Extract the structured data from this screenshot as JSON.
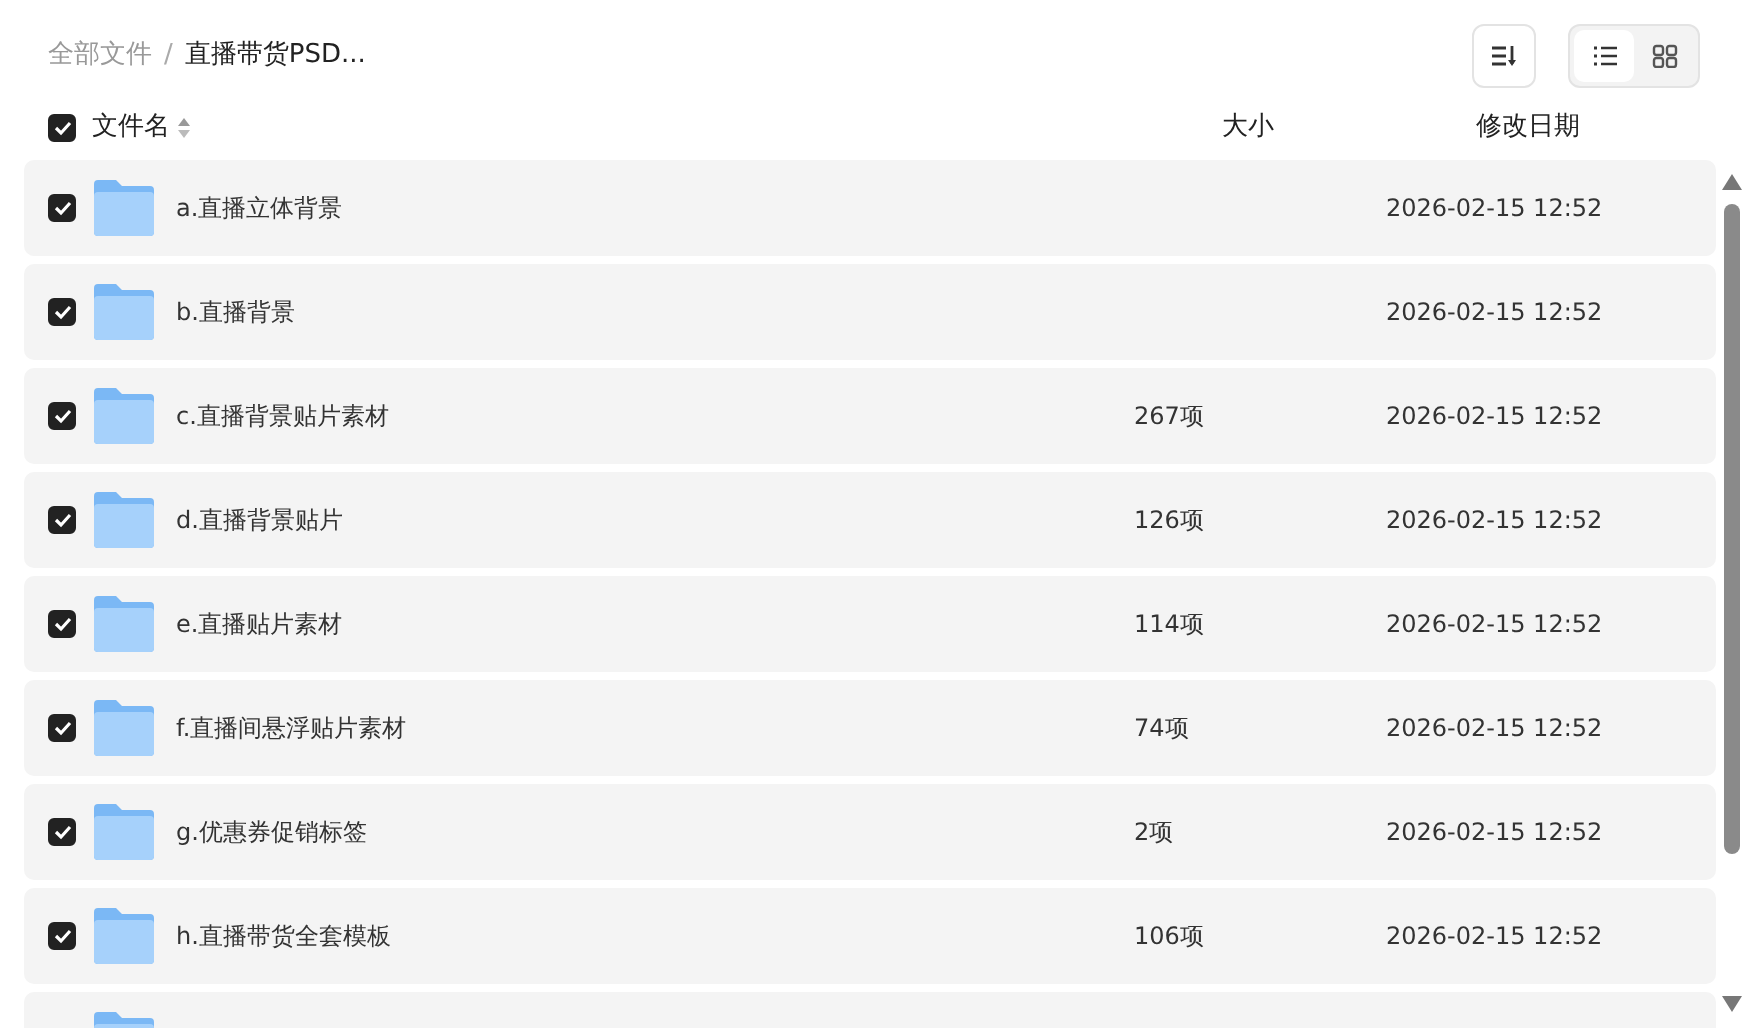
{
  "breadcrumb_separator": "/",
  "breadcrumb": [
    {
      "label": "全部文件",
      "current": false
    },
    {
      "label": "直播带货PSD...",
      "current": true
    }
  ],
  "view_modes": [
    {
      "kind": "list",
      "selected": true
    },
    {
      "kind": "grid",
      "selected": false
    }
  ],
  "header": {
    "checked": true,
    "name": "文件名",
    "size": "大小",
    "date": "修改日期"
  },
  "rows": [
    {
      "checked": true,
      "name": "a.直播立体背景",
      "date": "2026-02-15 12:52"
    },
    {
      "checked": true,
      "name": "b.直播背景",
      "date": "2026-02-15 12:52"
    },
    {
      "checked": true,
      "name": "c.直播背景贴片素材",
      "size": "267项",
      "date": "2026-02-15 12:52"
    },
    {
      "checked": true,
      "name": "d.直播背景贴片",
      "size": "126项",
      "date": "2026-02-15 12:52"
    },
    {
      "checked": true,
      "name": "e.直播贴片素材",
      "size": "114项",
      "date": "2026-02-15 12:52"
    },
    {
      "checked": true,
      "name": "f.直播间悬浮贴片素材",
      "size": "74项",
      "date": "2026-02-15 12:52"
    },
    {
      "checked": true,
      "name": "g.优惠券促销标签",
      "size": "2项",
      "date": "2026-02-15 12:52"
    },
    {
      "checked": true,
      "name": "h.直播带货全套模板",
      "size": "106项",
      "date": "2026-02-15 12:52"
    },
    {
      "kind": "partial"
    }
  ]
}
